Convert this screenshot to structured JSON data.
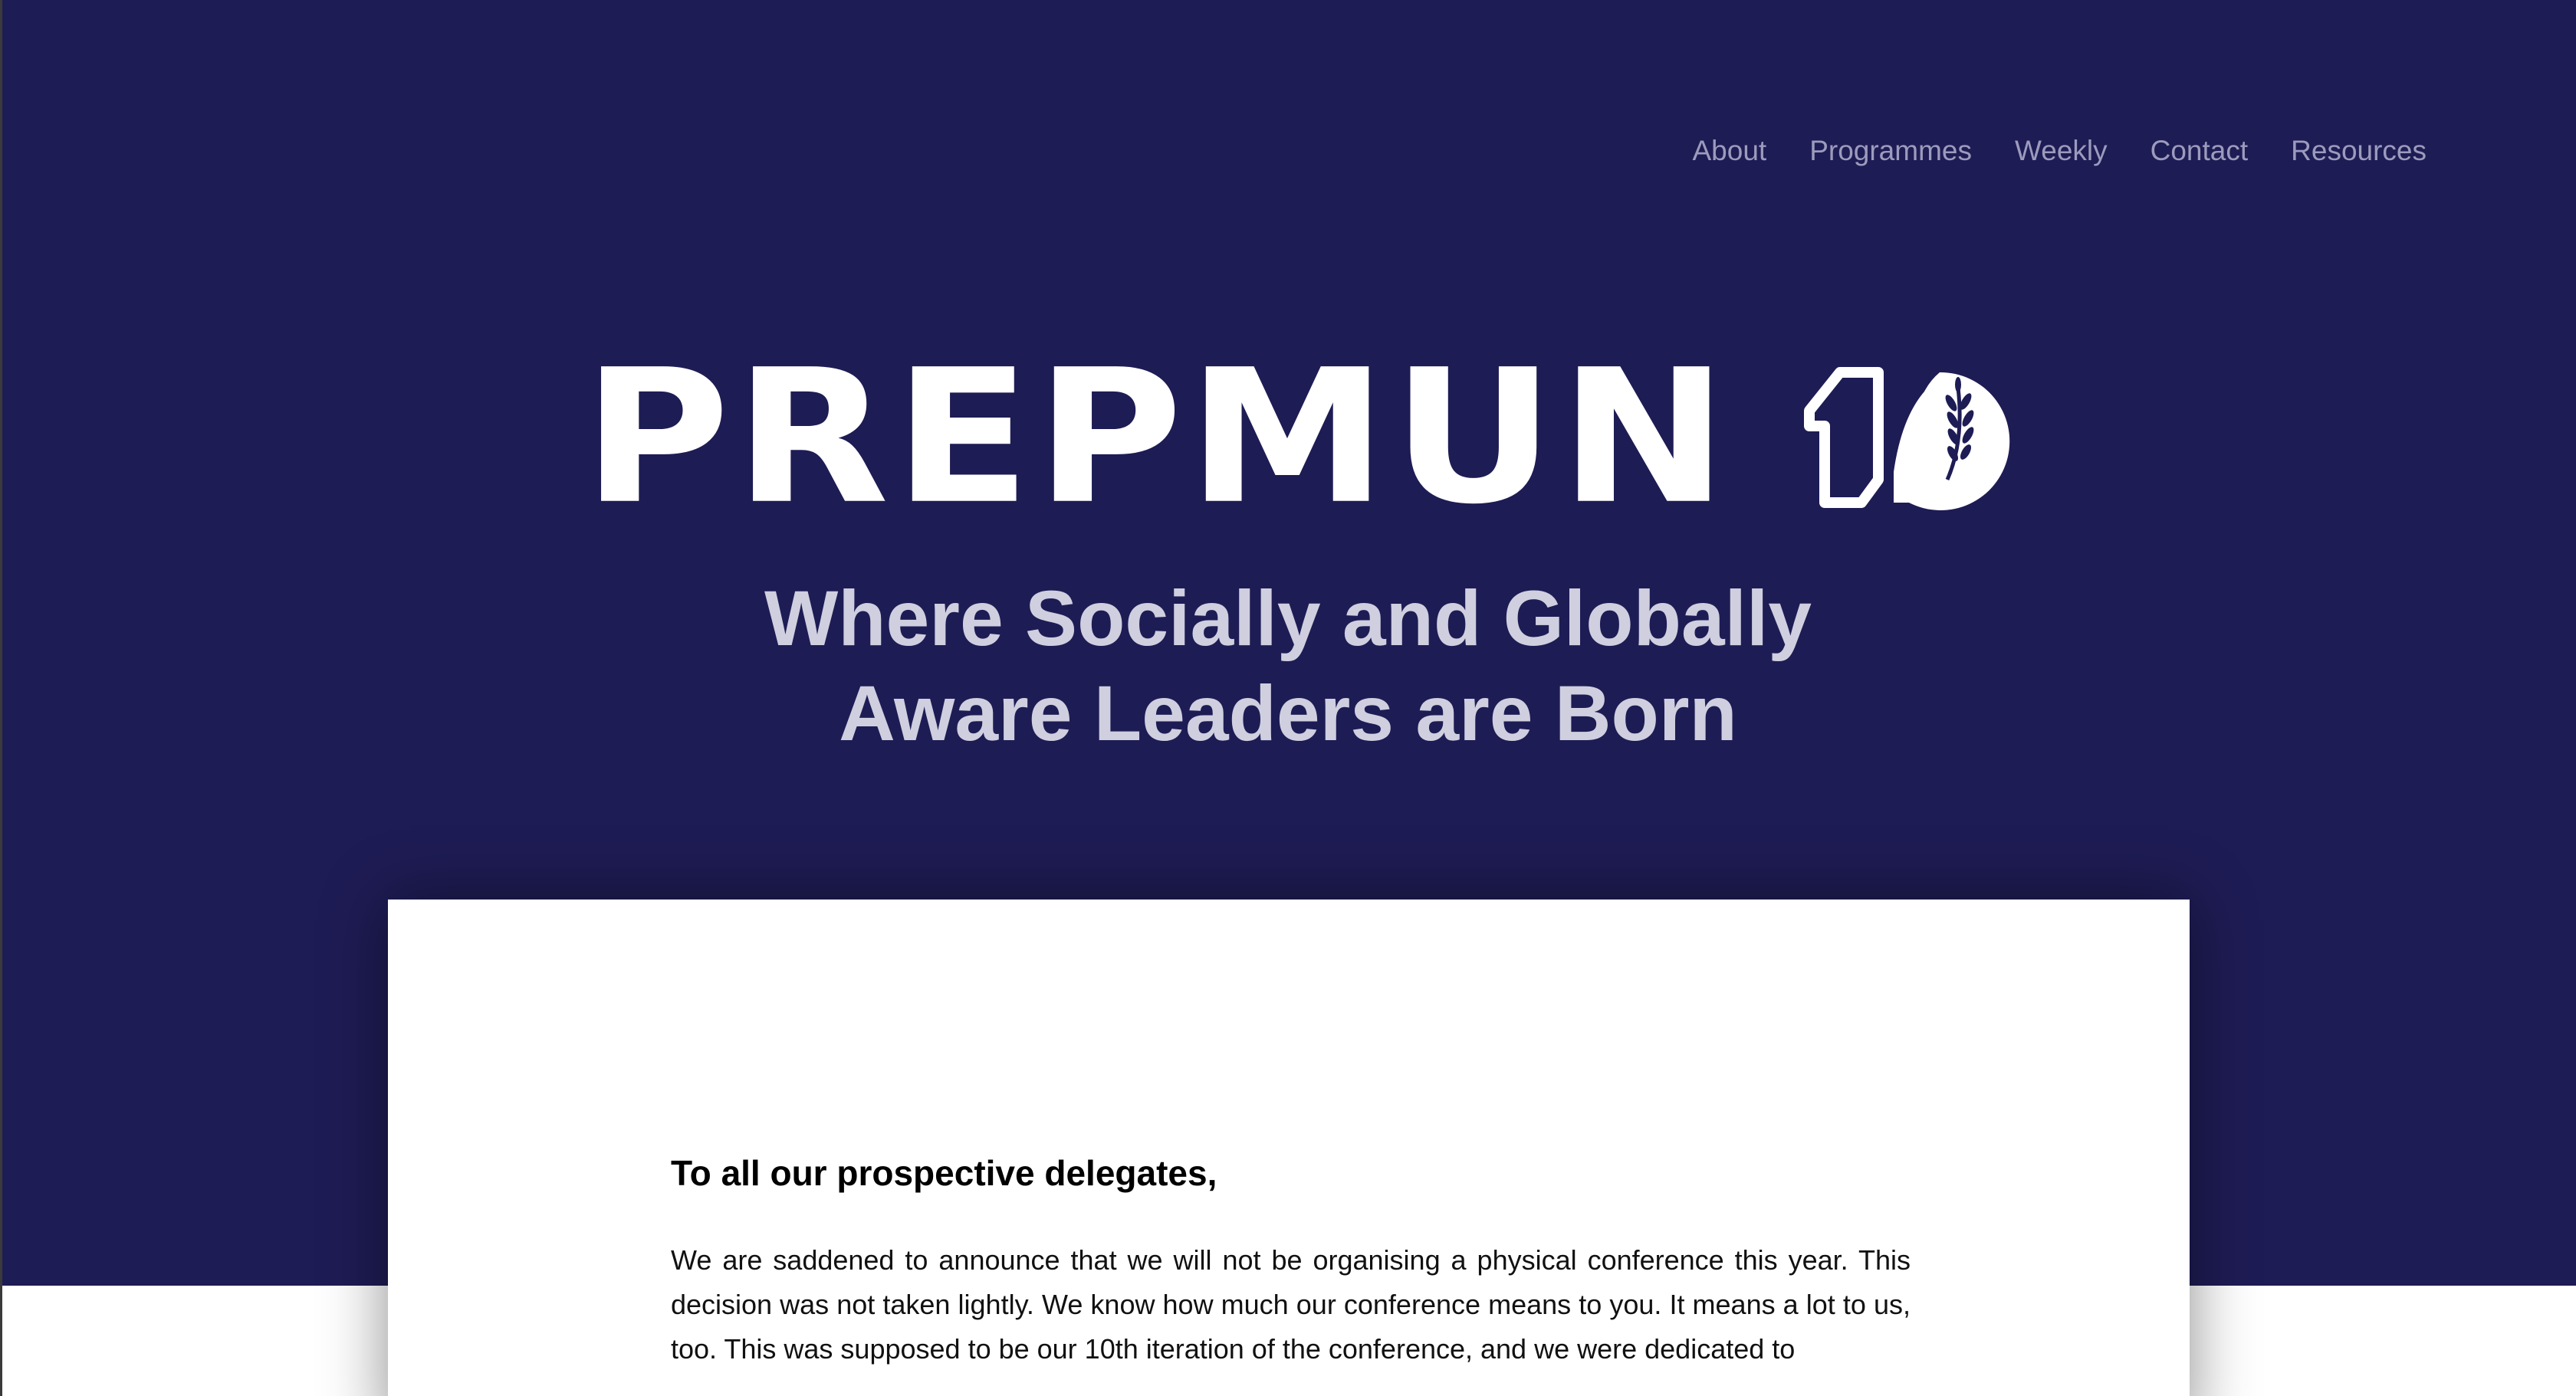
{
  "nav": {
    "items": [
      {
        "label": "About"
      },
      {
        "label": "Programmes"
      },
      {
        "label": "Weekly"
      },
      {
        "label": "Contact"
      },
      {
        "label": "Resources"
      }
    ]
  },
  "hero": {
    "logo_text": "PREPMUN",
    "logo_mark_icon": "ten-leaf-logo-icon",
    "tagline_line1": "Where Socially and Globally",
    "tagline_line2": "Aware Leaders are Born",
    "background_color": "#1e1c54"
  },
  "letter": {
    "heading": "To all our prospective delegates,",
    "body": "We are saddened to announce that we will not be organising a physical conference this year. This decision was not taken lightly. We know how much our conference means to you. It means a lot to us, too. This was supposed to be our 10th iteration of the conference, and we were dedicated to"
  }
}
